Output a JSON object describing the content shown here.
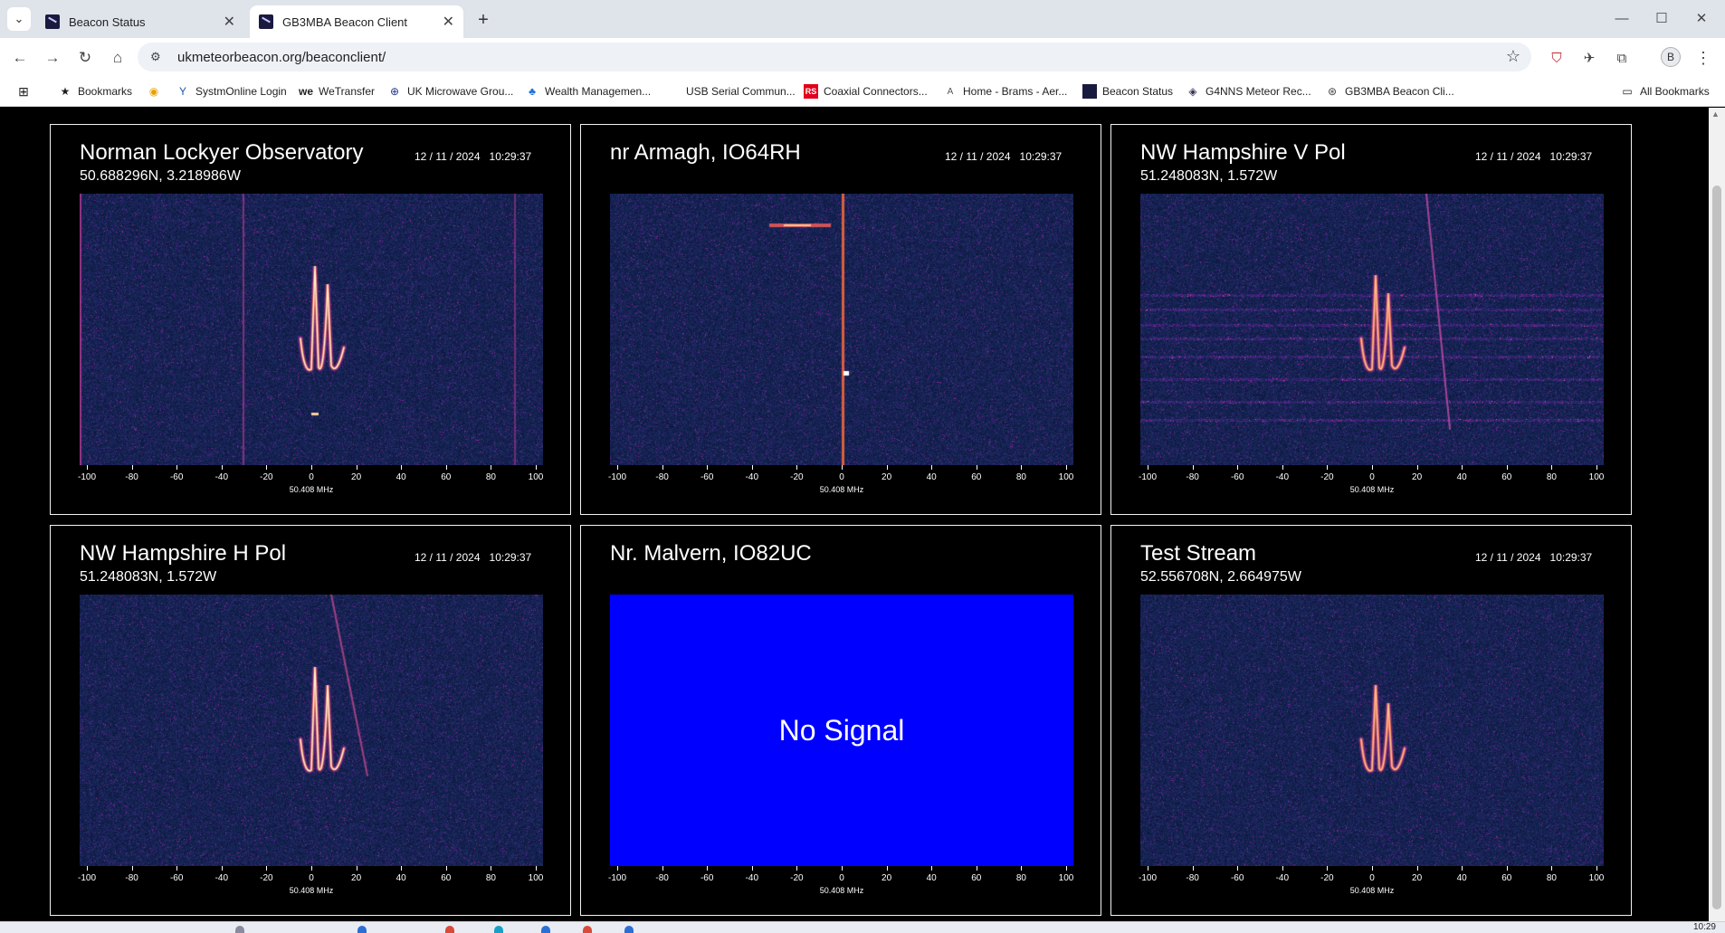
{
  "browser": {
    "tabs": [
      {
        "title": "Beacon Status",
        "active": false
      },
      {
        "title": "GB3MBA Beacon Client",
        "active": true
      }
    ],
    "url": "ukmeteorbeacon.org/beaconclient/",
    "avatar_letter": "B",
    "bookmarks": [
      {
        "label": "Bookmarks",
        "icon": "star-icon"
      },
      {
        "label": "",
        "icon": "chrome-icon"
      },
      {
        "label": "SystmOnline Login",
        "icon": "systmonline-icon"
      },
      {
        "label": "WeTransfer",
        "icon": "wetransfer-icon"
      },
      {
        "label": "UK Microwave Grou...",
        "icon": "microwave-group-icon"
      },
      {
        "label": "Wealth Managemen...",
        "icon": "wealth-icon"
      },
      {
        "label": "USB Serial Commun...",
        "icon": "usb-icon"
      },
      {
        "label": "Coaxial Connectors...",
        "icon": "rs-icon"
      },
      {
        "label": "Home - Brams - Aer...",
        "icon": "brams-icon"
      },
      {
        "label": "Beacon Status",
        "icon": "beacon-icon"
      },
      {
        "label": "G4NNS Meteor Rec...",
        "icon": "g4nns-icon"
      },
      {
        "label": "GB3MBA Beacon Cli...",
        "icon": "globe-icon"
      }
    ],
    "all_bookmarks": "All Bookmarks"
  },
  "axis": {
    "ticks": [
      "-100",
      "-80",
      "-60",
      "-40",
      "-20",
      "0",
      "20",
      "40",
      "60",
      "80",
      "100"
    ],
    "freq_label": "50.408 MHz"
  },
  "panels": [
    {
      "title": "Norman Lockyer Observatory",
      "coords": "50.688296N, 3.218986W",
      "date": "12 / 11 / 2024",
      "time": "10:29:37",
      "signal": true
    },
    {
      "title": "nr Armagh, IO64RH",
      "coords": "",
      "date": "12 / 11 / 2024",
      "time": "10:29:37",
      "signal": true
    },
    {
      "title": "NW Hampshire V Pol",
      "coords": "51.248083N, 1.572W",
      "date": "12 / 11 / 2024",
      "time": "10:29:37",
      "signal": true
    },
    {
      "title": "NW Hampshire H Pol",
      "coords": "51.248083N, 1.572W",
      "date": "12 / 11 / 2024",
      "time": "10:29:37",
      "signal": true
    },
    {
      "title": "Nr. Malvern, IO82UC",
      "coords": "",
      "date": "",
      "time": "",
      "signal": false,
      "no_signal_text": "No Signal"
    },
    {
      "title": "Test Stream",
      "coords": "52.556708N, 2.664975W",
      "date": "12 / 11 / 2024",
      "time": "10:29:37",
      "signal": true
    }
  ],
  "taskbar": {
    "clock": "10:29"
  }
}
